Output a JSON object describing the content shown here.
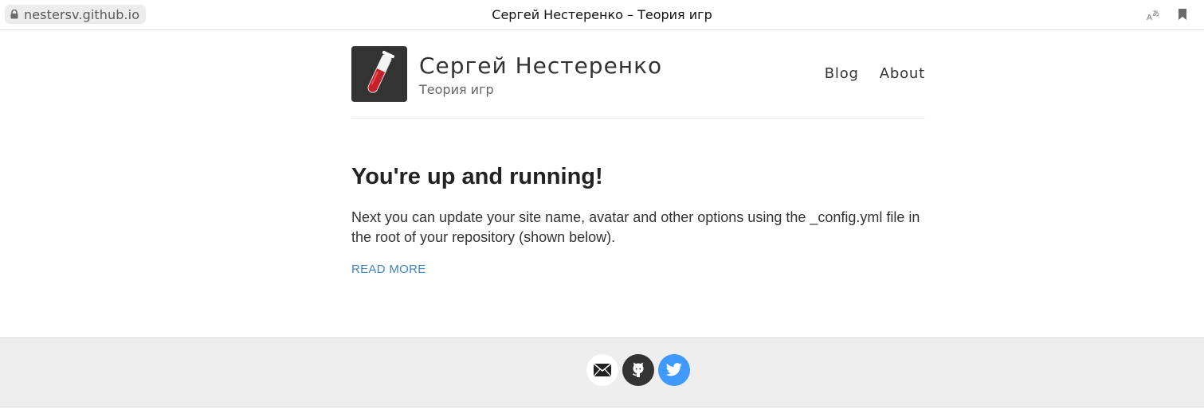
{
  "browser": {
    "url": "nestersv.github.io",
    "tab_title": "Сергей Нестеренко – Теория игр"
  },
  "header": {
    "site_name": "Сергей Нестеренко",
    "site_description": "Теория игр",
    "nav": [
      {
        "label": "Blog"
      },
      {
        "label": "About"
      }
    ]
  },
  "post": {
    "title": "You're up and running!",
    "excerpt": "Next you can update your site name, avatar and other options using the _config.yml file in the root of your repository (shown below).",
    "read_more_label": "READ MORE"
  },
  "footer": {
    "social": [
      {
        "name": "email",
        "icon": "envelope-icon",
        "color": "#ffffff"
      },
      {
        "name": "github",
        "icon": "github-icon",
        "color": "#333333"
      },
      {
        "name": "twitter",
        "icon": "twitter-icon",
        "color": "#4099ff"
      }
    ]
  },
  "colors": {
    "link": "#4183c4",
    "footer_bg": "#eeeeee"
  }
}
